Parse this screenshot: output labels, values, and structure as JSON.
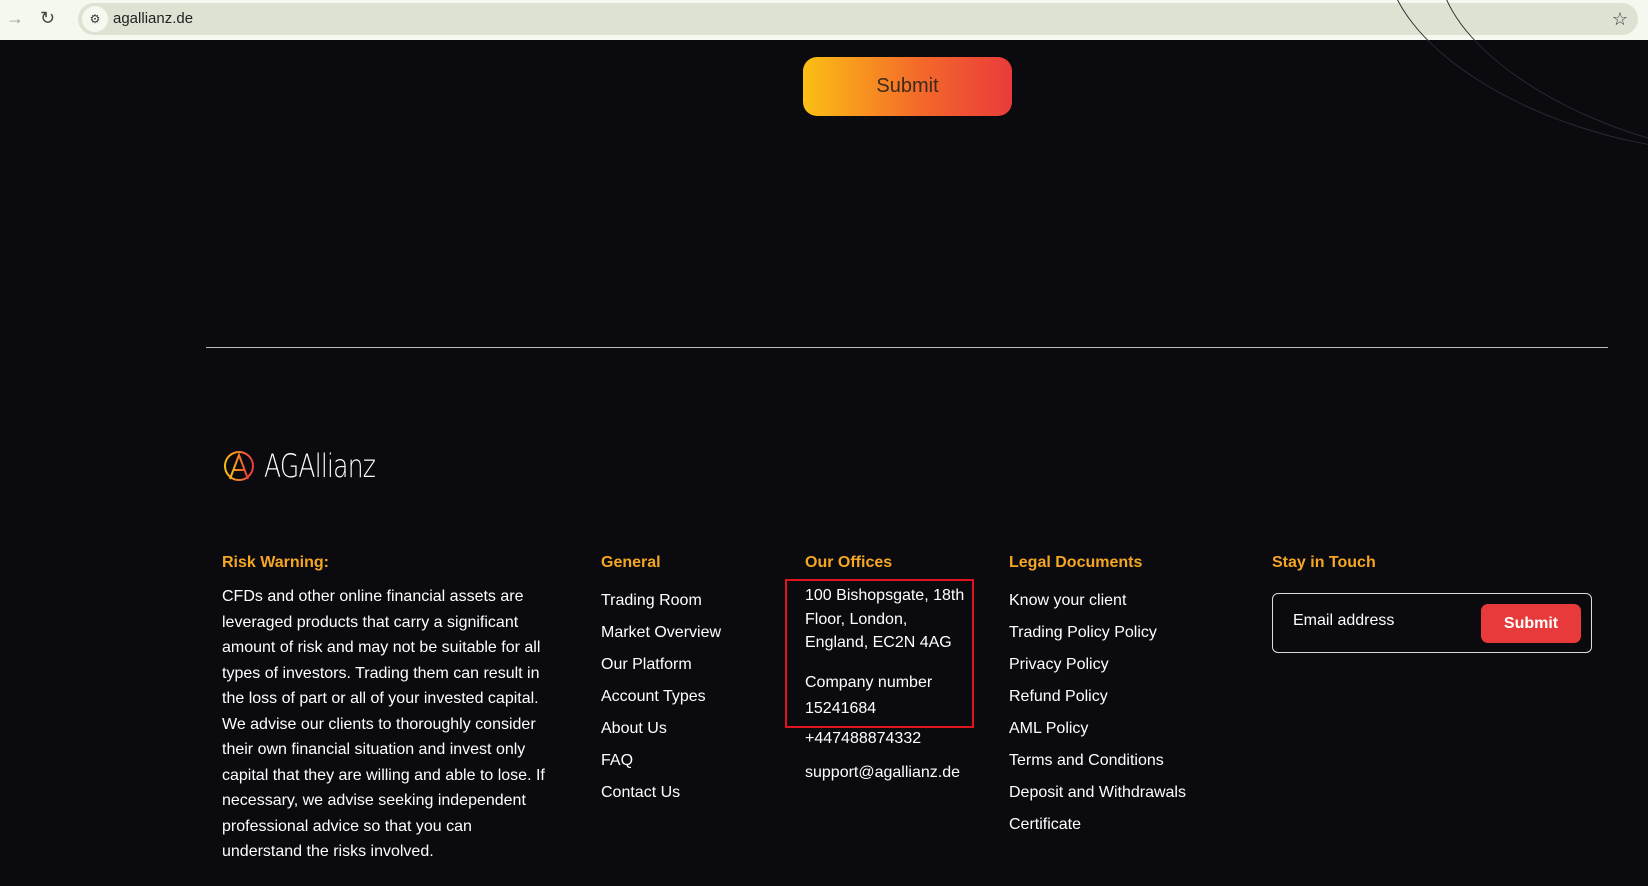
{
  "browser": {
    "url": "agallianz.de"
  },
  "top_submit": "Submit",
  "logo": {
    "name": "AGAllianz"
  },
  "risk": {
    "heading": "Risk Warning:",
    "text": "CFDs and other online financial assets are leveraged products that carry a significant amount of risk and may not be suitable for all types of investors. Trading them can result in the loss of part or all of your invested capital. We advise our clients to thoroughly consider their own financial situation and invest only capital that they are willing and able to lose. If necessary, we advise seeking independent professional advice so that you can understand the risks involved."
  },
  "general": {
    "heading": "General",
    "links": [
      "Trading Room",
      "Market Overview",
      "Our Platform",
      "Account Types",
      "About Us",
      "FAQ",
      "Contact Us"
    ]
  },
  "offices": {
    "heading": "Our Offices",
    "address": "100 Bishopsgate, 18th Floor, London, England, EC2N 4AG",
    "company": "Company number 15241684",
    "phone": "+447488874332",
    "email": "support@agallianz.de"
  },
  "legal": {
    "heading": "Legal Documents",
    "links": [
      "Know your client",
      "Trading Policy Policy",
      "Privacy Policy",
      "Refund Policy",
      "AML Policy",
      "Terms and Conditions",
      "Deposit and Withdrawals",
      "Certificate"
    ]
  },
  "newsletter": {
    "heading": "Stay in Touch",
    "placeholder": "Email address",
    "button": "Submit"
  }
}
